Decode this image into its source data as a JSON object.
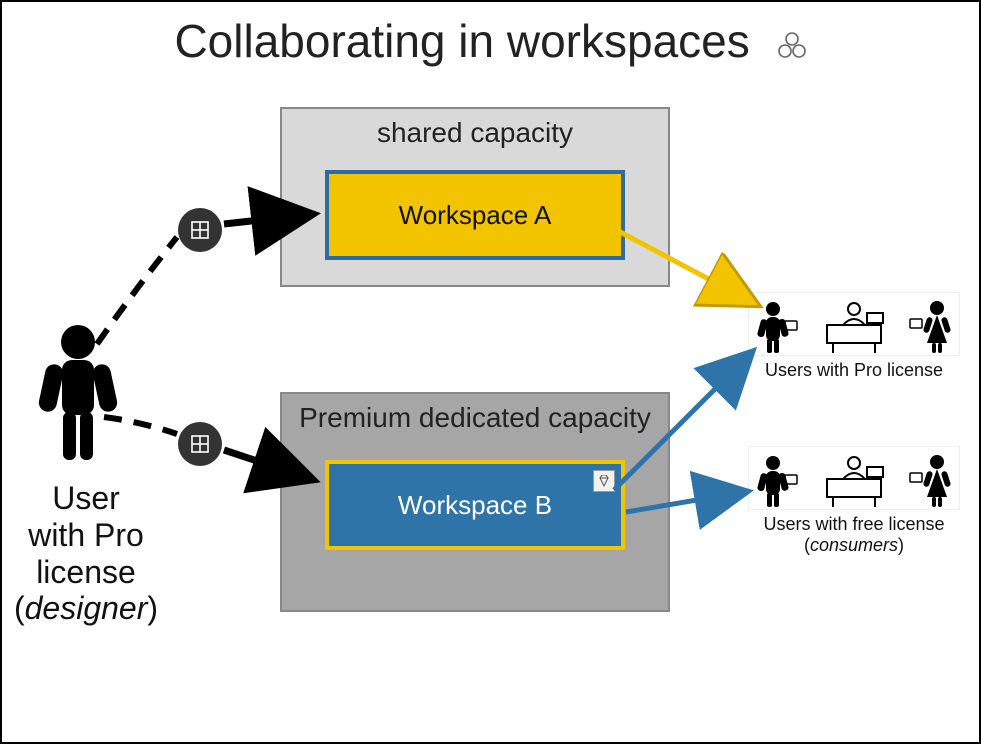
{
  "title": "Collaborating in workspaces",
  "designer": {
    "line1": "User",
    "line2": "with Pro",
    "line3": "license",
    "role": "(",
    "role_word": "designer",
    "role_close": ")"
  },
  "capacities": {
    "shared": {
      "label": "shared capacity"
    },
    "premium": {
      "label": "Premium dedicated capacity"
    }
  },
  "workspaces": {
    "a": {
      "label": "Workspace A"
    },
    "b": {
      "label": "Workspace B"
    }
  },
  "audiences": {
    "pro": {
      "label": "Users with Pro license"
    },
    "free": {
      "label": "Users with free license",
      "subrole_open": "(",
      "subrole": "consumers",
      "subrole_close": ")"
    }
  },
  "colors": {
    "yellow": "#f2c400",
    "blue": "#2e74a9",
    "grey1": "#d9d9d9",
    "grey2": "#a6a6a6",
    "arrow_dark": "#000000"
  }
}
